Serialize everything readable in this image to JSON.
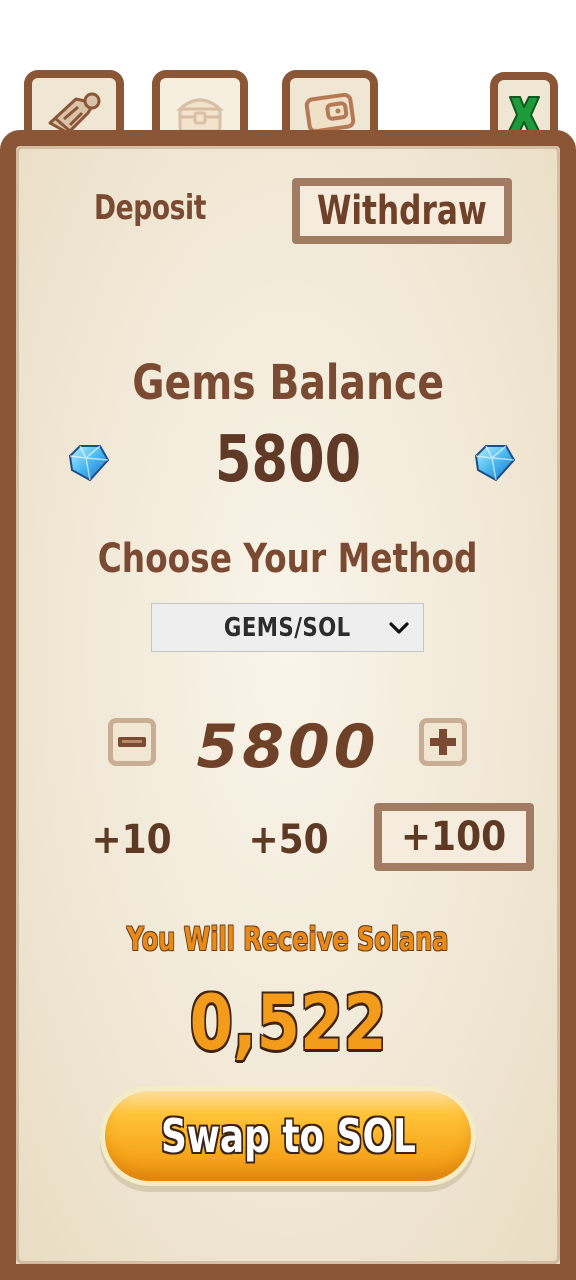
{
  "tabs": [
    {
      "icon": "scroll-icon"
    },
    {
      "icon": "treasure-chest-icon"
    },
    {
      "icon": "wallet-icon"
    }
  ],
  "close": {
    "label": "X",
    "color": "#1d9a3a"
  },
  "modes": {
    "deposit_label": "Deposit",
    "withdraw_label": "Withdraw",
    "active": "Withdraw"
  },
  "balance": {
    "title": "Gems Balance",
    "value": "5800",
    "icon": "gem-icon"
  },
  "method": {
    "title": "Choose Your Method",
    "selected": "GEMS/SOL"
  },
  "amount": {
    "value": "5800"
  },
  "quick_add": [
    {
      "label": "+10"
    },
    {
      "label": "+50"
    },
    {
      "label": "+100"
    }
  ],
  "receive": {
    "label": "You Will Receive Solana",
    "value": "0,522"
  },
  "swap_button": {
    "label": "Swap to SOL"
  },
  "colors": {
    "frame": "#8a5636",
    "paper": "#f1e8d6",
    "text_brown": "#7a4b32",
    "orange": "#f39b1a"
  }
}
